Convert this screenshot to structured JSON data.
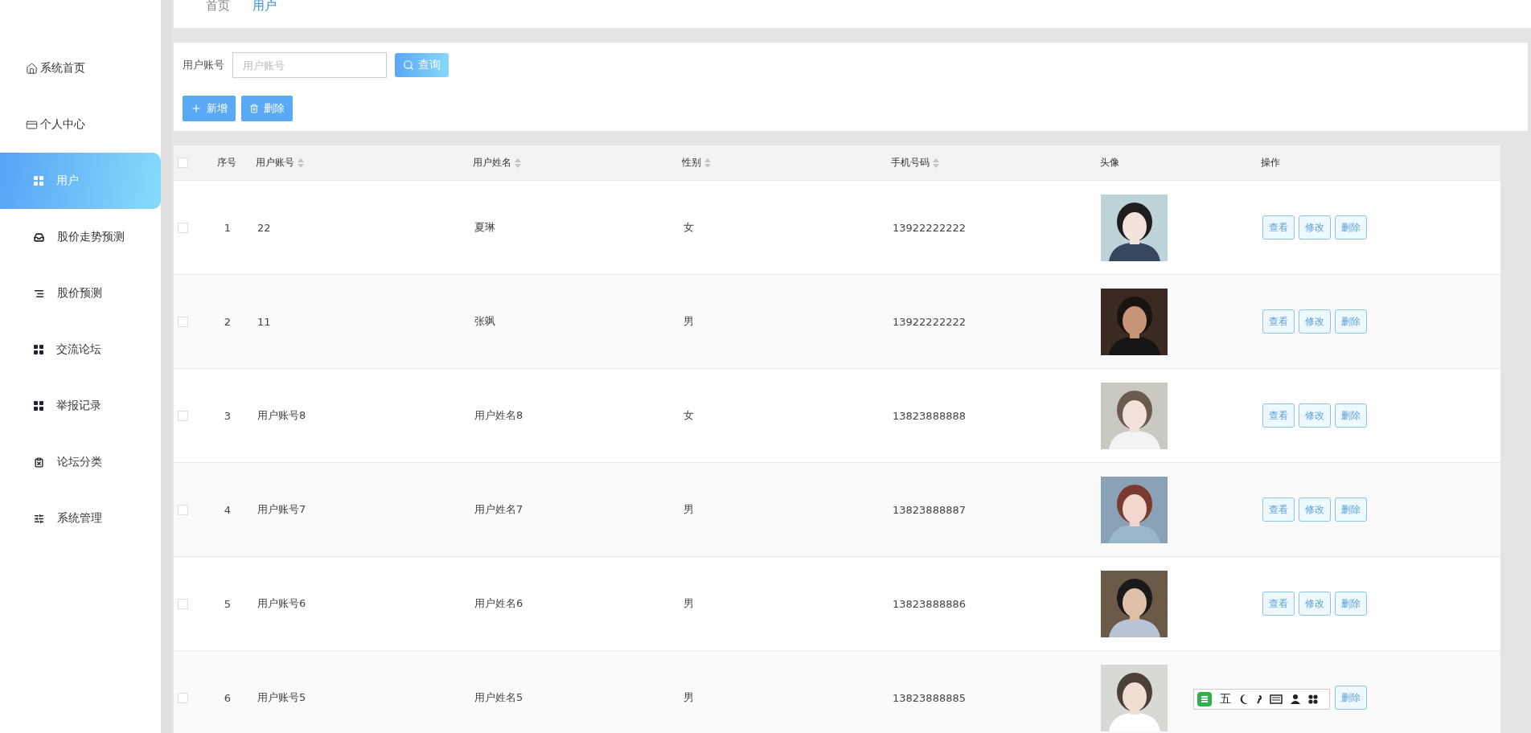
{
  "sidebar": {
    "items": [
      {
        "label": "系统首页",
        "kind": "link",
        "selected": false
      },
      {
        "label": "个人中心",
        "kind": "link",
        "selected": false
      },
      {
        "label": "用户",
        "kind": "menu",
        "selected": true
      },
      {
        "label": "股价走势预测",
        "kind": "menu",
        "selected": false
      },
      {
        "label": "股价预测",
        "kind": "menu",
        "selected": false
      },
      {
        "label": "交流论坛",
        "kind": "menu",
        "selected": false
      },
      {
        "label": "举报记录",
        "kind": "menu",
        "selected": false
      },
      {
        "label": "论坛分类",
        "kind": "menu",
        "selected": false
      },
      {
        "label": "系统管理",
        "kind": "menu",
        "selected": false
      }
    ]
  },
  "breadcrumb": [
    {
      "label": "首页",
      "selected": false
    },
    {
      "label": "用户",
      "selected": true
    }
  ],
  "search": {
    "label": "用户账号",
    "placeholder": "用户账号",
    "button": "查询"
  },
  "toolbar": [
    {
      "label": "新增"
    },
    {
      "label": "删除"
    }
  ],
  "table": {
    "select_all_checked": false,
    "columns": [
      {
        "label": "序号",
        "sortable": false
      },
      {
        "label": "用户账号",
        "sortable": true
      },
      {
        "label": "用户姓名",
        "sortable": true
      },
      {
        "label": "性别",
        "sortable": true
      },
      {
        "label": "手机号码",
        "sortable": true
      },
      {
        "label": "头像",
        "sortable": false
      },
      {
        "label": "操作",
        "sortable": false
      }
    ],
    "rows": [
      {
        "index": "1",
        "account": "22",
        "name": "夏琳",
        "gender": "女",
        "phone": "13922222222",
        "checked": false,
        "actions": [
          {
            "kind": "button",
            "label": "查看"
          },
          {
            "kind": "button",
            "label": "修改"
          },
          {
            "kind": "button",
            "label": "删除"
          }
        ]
      },
      {
        "index": "2",
        "account": "11",
        "name": "张飒",
        "gender": "男",
        "phone": "13922222222",
        "checked": false,
        "actions": [
          {
            "kind": "button",
            "label": "查看"
          },
          {
            "kind": "button",
            "label": "修改"
          },
          {
            "kind": "button",
            "label": "删除"
          }
        ]
      },
      {
        "index": "3",
        "account": "用户账号8",
        "name": "用户姓名8",
        "gender": "女",
        "phone": "13823888888",
        "checked": false,
        "actions": [
          {
            "kind": "button",
            "label": "查看"
          },
          {
            "kind": "button",
            "label": "修改"
          },
          {
            "kind": "button",
            "label": "删除"
          }
        ]
      },
      {
        "index": "4",
        "account": "用户账号7",
        "name": "用户姓名7",
        "gender": "男",
        "phone": "13823888887",
        "checked": false,
        "actions": [
          {
            "kind": "button",
            "label": "查看"
          },
          {
            "kind": "button",
            "label": "修改"
          },
          {
            "kind": "button",
            "label": "删除"
          }
        ]
      },
      {
        "index": "5",
        "account": "用户账号6",
        "name": "用户姓名6",
        "gender": "男",
        "phone": "13823888886",
        "checked": false,
        "actions": [
          {
            "kind": "button",
            "label": "查看"
          },
          {
            "kind": "button",
            "label": "修改"
          },
          {
            "kind": "button",
            "label": "删除"
          }
        ]
      },
      {
        "index": "6",
        "account": "用户账号5",
        "name": "用户姓名5",
        "gender": "男",
        "phone": "13823888885",
        "checked": false,
        "actions": [
          {
            "kind": "covered"
          },
          {
            "kind": "covered"
          },
          {
            "kind": "button",
            "label": "删除"
          }
        ]
      }
    ]
  },
  "ime_toolbar": {
    "label": "五"
  }
}
